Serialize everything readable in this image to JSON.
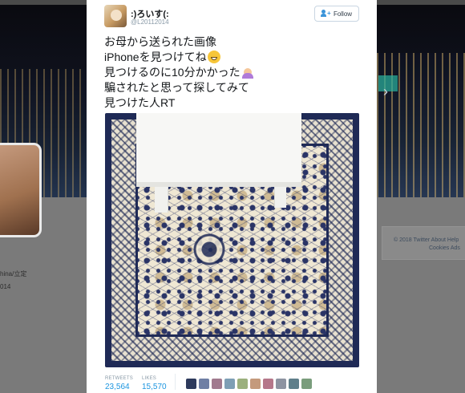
{
  "background": {
    "side_label": "hina/立定",
    "side_year": "014",
    "footer_line1": "© 2018 Twitter   About   Help",
    "footer_line2": "Cookies   Ads"
  },
  "tweet": {
    "display_name": ":)ろいす(:",
    "handle": "@L20112014",
    "follow_label": "Follow",
    "lines": [
      "お母から送られた画像",
      "iPhoneを見つけてね",
      "見つけるのに10分かかった",
      "騙されたと思って探してみて",
      "見つけた人RT"
    ],
    "line_emojis": [
      "",
      "grinning-face",
      "woman-raising-hand",
      "",
      ""
    ]
  },
  "stats": {
    "retweets_label": "RETWEETS",
    "retweets_value": "23,564",
    "likes_label": "LIKES",
    "likes_value": "15,570"
  },
  "liker_avatars": [
    "#2d3a5c",
    "#6f7fa4",
    "#a17a8e",
    "#7e9fb5",
    "#9bb07d",
    "#c49a7c",
    "#b5778a",
    "#8d93a1",
    "#5f7f8a",
    "#7a9d7c"
  ],
  "colors": {
    "link_blue": "#1b95e0",
    "follow_blue": "#3b94d9",
    "rug_navy": "#1f2a56"
  }
}
